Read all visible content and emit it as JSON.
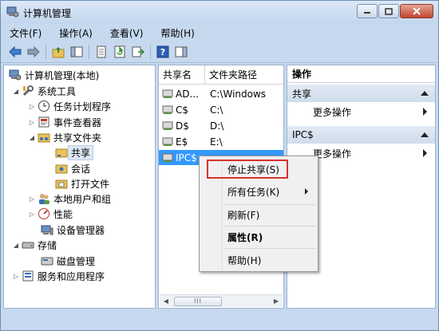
{
  "window": {
    "title": "计算机管理"
  },
  "menubar": {
    "items": [
      "文件(F)",
      "操作(A)",
      "查看(V)",
      "帮助(H)"
    ]
  },
  "toolbar": {
    "icons": [
      "back-icon",
      "forward-icon",
      "up-folder-icon",
      "show-hide-tree-icon",
      "properties-icon",
      "refresh-icon",
      "export-list-icon",
      "help-icon",
      "action-pane-icon"
    ]
  },
  "tree": {
    "root": "计算机管理(本地)",
    "system_tools": "系统工具",
    "task_scheduler": "任务计划程序",
    "event_viewer": "事件查看器",
    "shared_folders": "共享文件夹",
    "shares": "共享",
    "sessions": "会话",
    "open_files": "打开文件",
    "local_users": "本地用户和组",
    "performance": "性能",
    "device_manager": "设备管理器",
    "storage": "存储",
    "disk_management": "磁盘管理",
    "services_apps": "服务和应用程序"
  },
  "list": {
    "col_name": "共享名",
    "col_path": "文件夹路径",
    "rows": [
      {
        "name": "AD...",
        "path": "C:\\Windows"
      },
      {
        "name": "C$",
        "path": "C:\\"
      },
      {
        "name": "D$",
        "path": "D:\\"
      },
      {
        "name": "E$",
        "path": "E:\\"
      },
      {
        "name": "IPC$",
        "path": ""
      }
    ],
    "scroll_thumb": "III"
  },
  "actions": {
    "title": "操作",
    "section1": "共享",
    "section1_more": "更多操作",
    "section2": "IPC$",
    "section2_more": "更多操作"
  },
  "context_menu": {
    "stop_share": "停止共享(S)",
    "all_tasks": "所有任务(K)",
    "refresh": "刷新(F)",
    "properties": "属性(R)",
    "help": "帮助(H)"
  },
  "colors": {
    "selection": "#3399ff",
    "highlight_box": "#d7322f",
    "window_frame": "#c6d9ef"
  }
}
